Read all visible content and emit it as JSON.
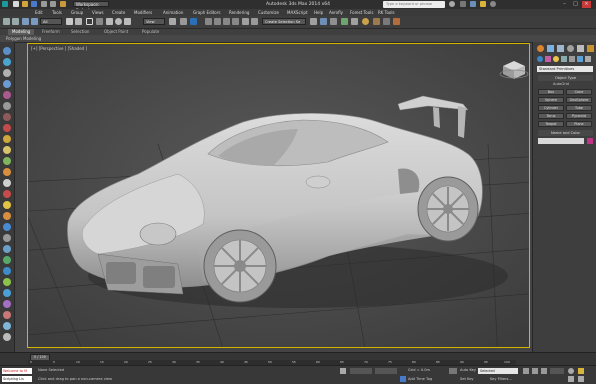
{
  "titlebar": {
    "workspace": "Workspace: Default",
    "title": "Autodesk 3ds Max  2014 x64",
    "search_placeholder": "Type a keyword or phrase"
  },
  "menu": [
    "Edit",
    "Tools",
    "Group",
    "Views",
    "Create",
    "Modifiers",
    "Animation",
    "Graph Editors",
    "Rendering",
    "Customize",
    "MAXScript",
    "Help",
    "Aerofly",
    "Forest Tools",
    "RK Tools"
  ],
  "toolbar": {
    "selection_filter": "All",
    "view_dropdown": "View",
    "named_selection": "Create Selection Se"
  },
  "ribbon": {
    "tabs": [
      "Modeling",
      "Freeform",
      "Selection",
      "Object Paint",
      "Populate"
    ],
    "subtitle": "Polygon Modeling"
  },
  "viewport": {
    "label": "[+] [Perspective ] [Shaded ]"
  },
  "command_panel": {
    "category_dropdown": "Standard Primitives",
    "object_type_header": "Object Type",
    "autogrid": "AutoGrid",
    "buttons": [
      "Box",
      "Cone",
      "Sphere",
      "GeoSphere",
      "Cylinder",
      "Tube",
      "Torus",
      "Pyramid",
      "Teapot",
      "Plane"
    ],
    "name_color_header": "Name and Color"
  },
  "timeline": {
    "frame": "0 / 100",
    "ticks": [
      "0",
      "5",
      "10",
      "15",
      "20",
      "25",
      "30",
      "35",
      "40",
      "45",
      "50",
      "55",
      "60",
      "65",
      "70",
      "75",
      "80",
      "85",
      "90",
      "95",
      "100"
    ]
  },
  "status": {
    "maxscript_label": "Welcome to M",
    "scripting_label": "Scripting Lis",
    "selection": "None Selected",
    "prompt": "Click and drag to pan a non-camera view",
    "grid": "Grid = 0.0m",
    "add_time_tag": "Add Time Tag",
    "auto_key": "Auto Key",
    "set_key": "Set Key",
    "selected_dropdown": "Selected",
    "key_filters": "Key Filters..."
  },
  "colors": {
    "viewport_border": "#d4b200",
    "accent_blue": "#2b6fb7",
    "viewport_bg": "#4b4b4b",
    "swatch": "#c0338a"
  }
}
